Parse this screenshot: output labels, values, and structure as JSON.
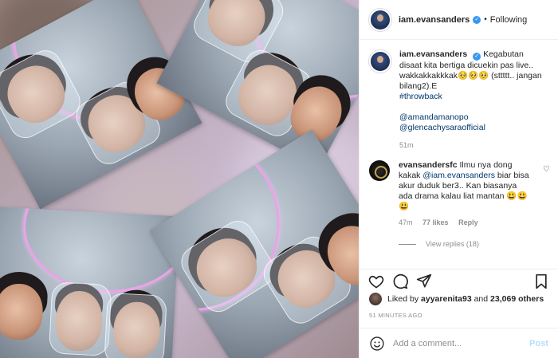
{
  "header": {
    "username": "iam.evansanders",
    "separator": "•",
    "follow_status": "Following"
  },
  "caption": {
    "username": "iam.evansanders",
    "text_1": "Kegabutan disaat kita bertiga dicuekin pas live.. wakkakkakkkak🥺🥺🥺 (sttttt.. jangan bilang2).E",
    "hashtag": "#throwback",
    "mention_1": "@amandamanopo",
    "mention_2": "@glencachysaraofficial",
    "time": "51m"
  },
  "comment": {
    "username": "evansandersfc",
    "text_before": "Ilmu nya dong kakak",
    "mention": "@iam.evansanders",
    "text_after": "biar bisa akur duduk ber3.. Kan biasanya ada drama kalau liat mantan 😃😃😃",
    "time": "47m",
    "likes": "77 likes",
    "reply": "Reply",
    "view_replies": "View replies (18)"
  },
  "likes": {
    "prefix": "Liked by",
    "user": "ayyarenita93",
    "and": "and",
    "others": "23,069 others"
  },
  "timestamp": "51 MINUTES AGO",
  "add_comment": {
    "placeholder": "Add a comment...",
    "post_label": "Post"
  },
  "icons": {
    "like": "heart-icon",
    "comment": "comment-icon",
    "share": "share-icon",
    "save": "bookmark-icon",
    "emoji": "emoji-icon",
    "verified": "verified-badge-icon"
  },
  "colors": {
    "link": "#00376b",
    "verified": "#3897f0",
    "muted": "#8e8e8e",
    "post_disabled": "#b2dffc"
  }
}
